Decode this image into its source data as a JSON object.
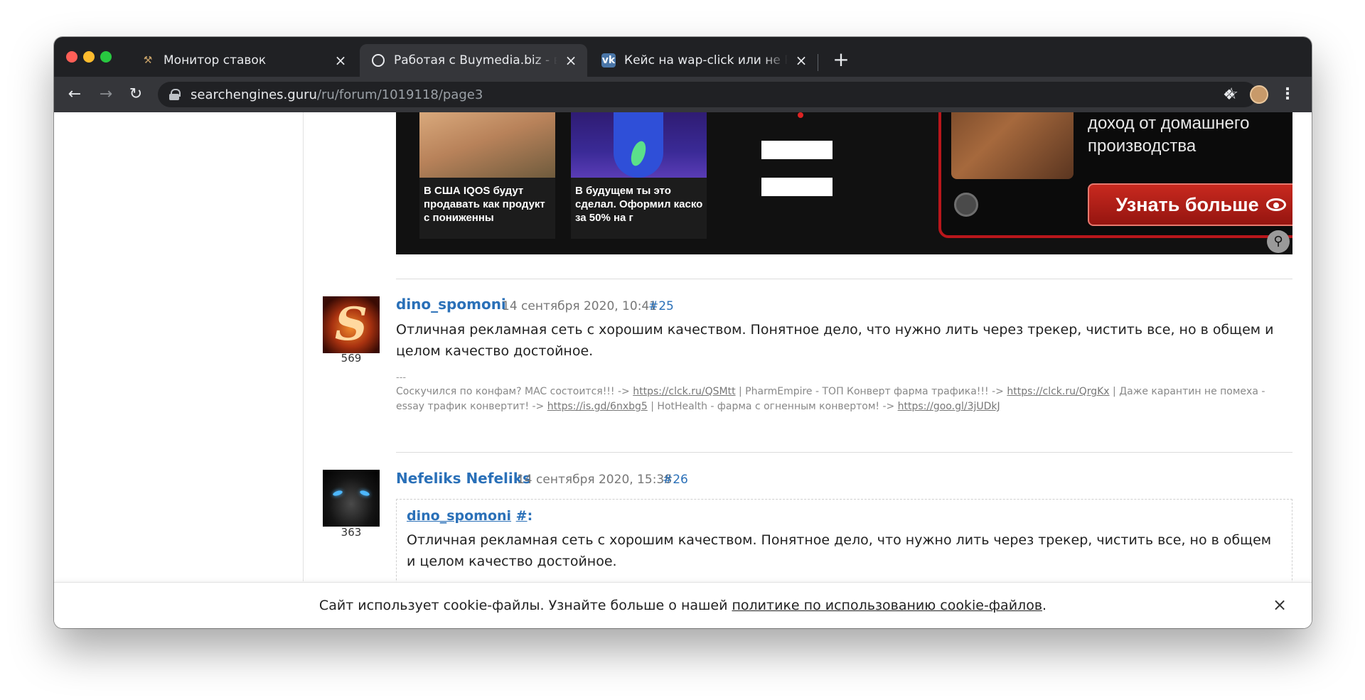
{
  "browser": {
    "tabs": [
      {
        "title": "Монитор ставок",
        "icon": "hammer-icon"
      },
      {
        "title": "Работая с Buymedia.biz - вы р",
        "icon": "search-icon"
      },
      {
        "title": "Кейс на wap-click или не Росс",
        "icon": "vk-icon"
      }
    ],
    "url_host": "searchengines.guru",
    "url_path": "/ru/forum/1019118/page3",
    "colors": {
      "frame": "#202124",
      "toolbar": "#35363a"
    }
  },
  "ad": {
    "card1_caption": "В США IQOS будут продавать как продукт с пониженны",
    "card2_caption": "В будущем ты это сделал. Оформил каско за 50% на г",
    "promo_text_line1": "доход от домашнего",
    "promo_text_line2": "производства",
    "cta_label": "Узнать больше",
    "accent_color": "#b9161b"
  },
  "posts": [
    {
      "author": "dino_spomoni",
      "date": "14 сентября 2020, 10:41",
      "number": "#25",
      "post_count": "569",
      "body": "Отличная рекламная сеть с хорошим качеством. Понятное дело, что нужно лить через трекер, чистить все, но в общем и целом качество достойное.",
      "signature_sep": "---",
      "signature": {
        "t1": "Соскучился по конфам? MAC состоится!!! -> ",
        "l1": "https://clck.ru/QSMtt",
        "t2": " | PharmEmpire - ТОП Конверт фарма трафика!!! -> ",
        "l2": "https://clck.ru/QrgKx",
        "t3": " | Даже карантин не помеха - essay трафик конвертит! -> ",
        "l3": "https://is.gd/6nxbg5",
        "t4": " | HotHealth - фарма с огненным конвертом! -> ",
        "l4": "https://goo.gl/3jUDkJ"
      }
    },
    {
      "author": "Nefeliks Nefeliks",
      "date": "14 сентября 2020, 15:38",
      "number": "#26",
      "post_count": "363",
      "quote_author": "dino_spomoni",
      "quote_link": "#",
      "quote_colon": ":",
      "quote_body": "Отличная рекламная сеть с хорошим качеством. Понятное дело, что нужно лить через трекер, чистить все, но в общем и целом качество достойное."
    }
  ],
  "cookie": {
    "text": "Сайт использует cookie-файлы. Узнайте больше о нашей ",
    "link": "политике по использованию cookie-файлов",
    "end": "."
  },
  "colors": {
    "link": "#2a70b8"
  }
}
